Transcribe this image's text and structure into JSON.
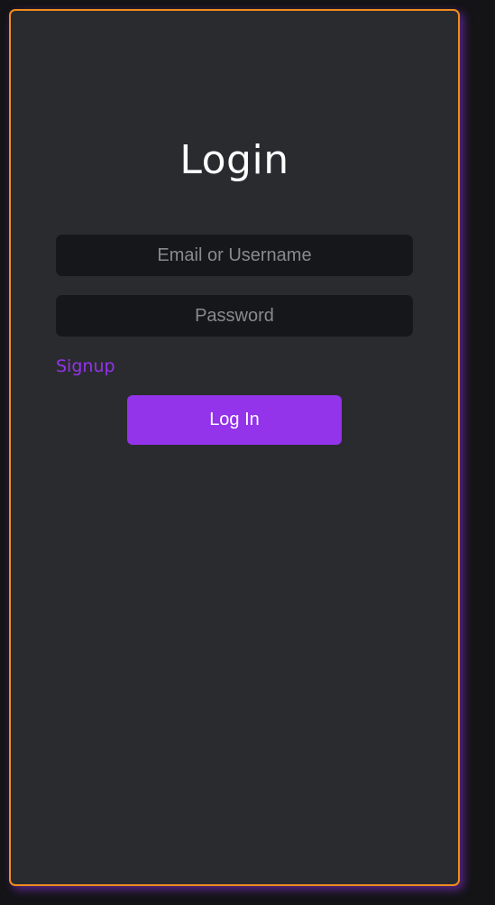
{
  "login": {
    "title": "Login",
    "email_placeholder": "Email or Username",
    "email_value": "",
    "password_placeholder": "Password",
    "password_value": "",
    "signup_link": "Signup",
    "submit_label": "Log In"
  },
  "colors": {
    "page_background": "#141417",
    "card_background": "#2a2b2f",
    "card_border": "#f08c1e",
    "input_background": "#16171a",
    "accent": "#9333ea",
    "title_text": "#ffffff"
  }
}
